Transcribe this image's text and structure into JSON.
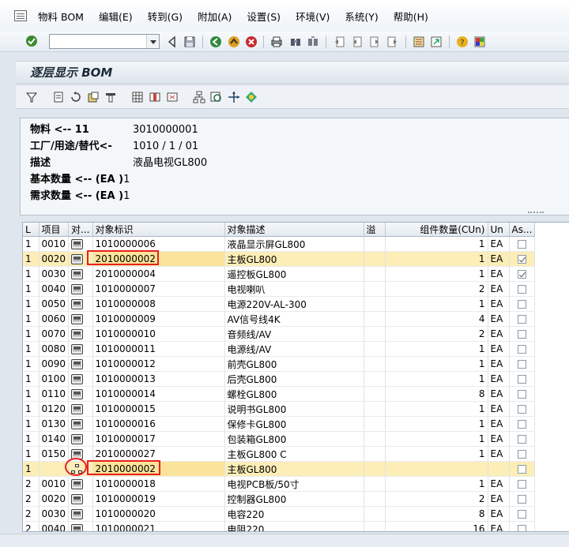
{
  "menu": {
    "items": [
      "物料 BOM",
      "编辑(E)",
      "转到(G)",
      "附加(A)",
      "设置(S)",
      "环境(V)",
      "系统(Y)",
      "帮助(H)"
    ]
  },
  "systoolbar": {
    "command_value": ""
  },
  "title": "逐层显示 BOM",
  "header": {
    "rows": [
      {
        "label": "物料 <-- 11",
        "value": "3010000001"
      },
      {
        "label": "工厂/用途/替代<-",
        "value": "1010 / 1 / 01"
      },
      {
        "label": "描述",
        "value": "液晶电视GL800"
      },
      {
        "label": "基本数量 <-- (EA )",
        "value": "1"
      },
      {
        "label": "需求数量 <-- (EA )",
        "value": "1"
      }
    ]
  },
  "grid": {
    "columns": [
      "L",
      "项目",
      "对...",
      "对象标识",
      "对象描述",
      "溢",
      "组件数量(CUn)",
      "Un",
      "As..."
    ],
    "rows": [
      {
        "level": "1",
        "item": "0010",
        "icon": "material-object-icon",
        "id": "1010000006",
        "desc": "液晶显示屏GL800",
        "qty": "1",
        "unit": "EA",
        "checked": false
      },
      {
        "level": "1",
        "item": "0020",
        "icon": "material-object-icon",
        "id": "2010000002",
        "desc": "主板GL800",
        "qty": "1",
        "unit": "EA",
        "checked": true,
        "selected": true
      },
      {
        "level": "1",
        "item": "0030",
        "icon": "material-object-icon",
        "id": "2010000004",
        "desc": "遥控板GL800",
        "qty": "1",
        "unit": "EA",
        "checked": true
      },
      {
        "level": "1",
        "item": "0040",
        "icon": "material-object-icon",
        "id": "1010000007",
        "desc": "电视喇叭",
        "qty": "2",
        "unit": "EA",
        "checked": false
      },
      {
        "level": "1",
        "item": "0050",
        "icon": "material-object-icon",
        "id": "1010000008",
        "desc": "电源220V-AL-300",
        "qty": "1",
        "unit": "EA",
        "checked": false
      },
      {
        "level": "1",
        "item": "0060",
        "icon": "material-object-icon",
        "id": "1010000009",
        "desc": "AV信号线4K",
        "qty": "4",
        "unit": "EA",
        "checked": false
      },
      {
        "level": "1",
        "item": "0070",
        "icon": "material-object-icon",
        "id": "1010000010",
        "desc": "音频线/AV",
        "qty": "2",
        "unit": "EA",
        "checked": false
      },
      {
        "level": "1",
        "item": "0080",
        "icon": "material-object-icon",
        "id": "1010000011",
        "desc": "电源线/AV",
        "qty": "1",
        "unit": "EA",
        "checked": false
      },
      {
        "level": "1",
        "item": "0090",
        "icon": "material-object-icon",
        "id": "1010000012",
        "desc": "前壳GL800",
        "qty": "1",
        "unit": "EA",
        "checked": false
      },
      {
        "level": "1",
        "item": "0100",
        "icon": "material-object-icon",
        "id": "1010000013",
        "desc": "后壳GL800",
        "qty": "1",
        "unit": "EA",
        "checked": false
      },
      {
        "level": "1",
        "item": "0110",
        "icon": "material-object-icon",
        "id": "1010000014",
        "desc": "螺栓GL800",
        "qty": "8",
        "unit": "EA",
        "checked": false
      },
      {
        "level": "1",
        "item": "0120",
        "icon": "material-object-icon",
        "id": "1010000015",
        "desc": "说明书GL800",
        "qty": "1",
        "unit": "EA",
        "checked": false
      },
      {
        "level": "1",
        "item": "0130",
        "icon": "material-object-icon",
        "id": "1010000016",
        "desc": "保修卡GL800",
        "qty": "1",
        "unit": "EA",
        "checked": false
      },
      {
        "level": "1",
        "item": "0140",
        "icon": "material-object-icon",
        "id": "1010000017",
        "desc": "包装箱GL800",
        "qty": "1",
        "unit": "EA",
        "checked": false
      },
      {
        "level": "1",
        "item": "0150",
        "icon": "material-object-icon",
        "id": "2010000027",
        "desc": "主板GL800 C",
        "qty": "1",
        "unit": "EA",
        "checked": false
      },
      {
        "level": "1",
        "item": "",
        "icon": "bom-tree-icon",
        "id": "2010000002",
        "desc": "主板GL800",
        "qty": "",
        "unit": "",
        "checked": false,
        "highlight": true
      },
      {
        "level": "2",
        "item": "0010",
        "icon": "material-object-icon",
        "id": "1010000018",
        "desc": "电视PCB板/50寸",
        "qty": "1",
        "unit": "EA",
        "checked": false
      },
      {
        "level": "2",
        "item": "0020",
        "icon": "material-object-icon",
        "id": "1010000019",
        "desc": "控制器GL800",
        "qty": "2",
        "unit": "EA",
        "checked": false
      },
      {
        "level": "2",
        "item": "0030",
        "icon": "material-object-icon",
        "id": "1010000020",
        "desc": "电容220",
        "qty": "8",
        "unit": "EA",
        "checked": false
      },
      {
        "level": "2",
        "item": "0040",
        "icon": "material-object-icon",
        "id": "1010000021",
        "desc": "电阻220",
        "qty": "16",
        "unit": "EA",
        "checked": false
      }
    ]
  },
  "colors": {
    "highlight_row": "#fdeeb7",
    "annotation_red": "#e8201f"
  }
}
